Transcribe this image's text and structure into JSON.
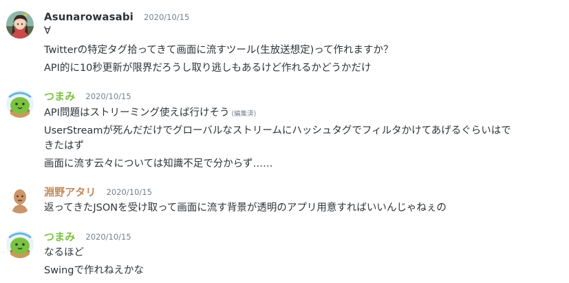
{
  "messages": [
    {
      "username": "Asunarowasabi",
      "username_color": "#2e3338",
      "avatar": "anime-character-avatar-icon",
      "timestamp": "2020/10/15",
      "lines": [
        "∀",
        "Twitterの特定タグ拾ってきて画面に流すツール(生放送想定)って作れますか？",
        "API的に10秒更新が限界だろうし取り逃しもあるけど作れるかどうかだけ"
      ]
    },
    {
      "username": "つまみ",
      "username_color": "#7cc242",
      "avatar": "green-blob-avatar-icon",
      "timestamp": "2020/10/15",
      "lines": [
        "API問題はストリーミング使えば行けそう",
        "UserStreamが死んだだけでグローバルなストリームにハッシュタグでフィルタかけてあげるぐらいはで",
        "きたはず",
        "画面に流す云々については知識不足で分からず……"
      ],
      "edited_label": "(編集済)"
    },
    {
      "username": "淵野アタリ",
      "username_color": "#c08a5a",
      "avatar": "brown-figure-avatar-icon",
      "timestamp": "2020/10/15",
      "lines": [
        "返ってきたJSONを受け取って画面に流す背景が透明のアプリ用意すればいいんじゃねぇの"
      ]
    },
    {
      "username": "つまみ",
      "username_color": "#7cc242",
      "avatar": "green-blob-avatar-icon",
      "timestamp": "2020/10/15",
      "lines": [
        "なるほど",
        "Swingで作れねえかな"
      ]
    }
  ]
}
